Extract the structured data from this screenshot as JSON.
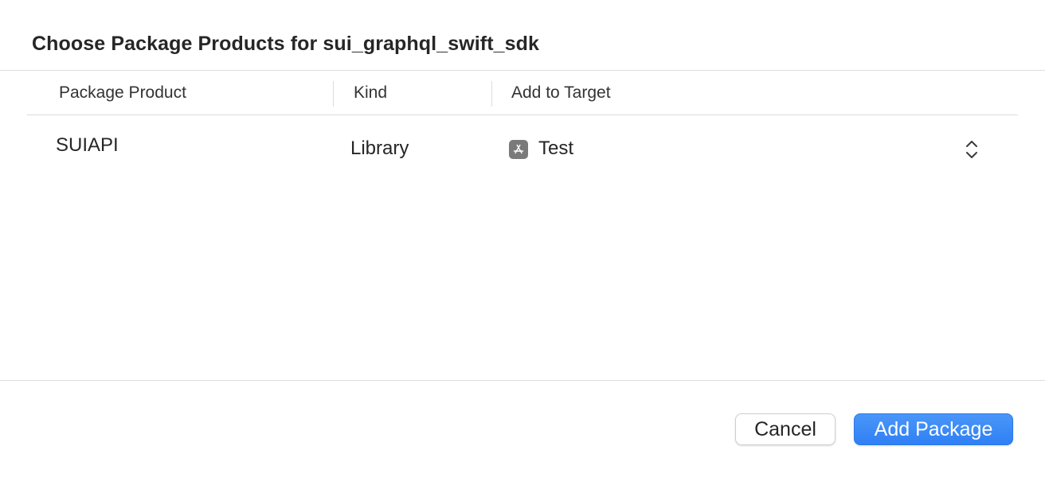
{
  "dialog": {
    "title": "Choose Package Products for sui_graphql_swift_sdk"
  },
  "table": {
    "columns": [
      {
        "label": "Package Product"
      },
      {
        "label": "Kind"
      },
      {
        "label": "Add to Target"
      }
    ],
    "rows": [
      {
        "product": "SUIAPI",
        "kind": "Library",
        "target": "Test",
        "target_icon": "app-store-icon"
      }
    ]
  },
  "buttons": {
    "cancel_label": "Cancel",
    "primary_label": "Add Package"
  },
  "colors": {
    "accent": "#3185F6",
    "primary_text": "#262626",
    "divider": "#DEDEDE"
  }
}
